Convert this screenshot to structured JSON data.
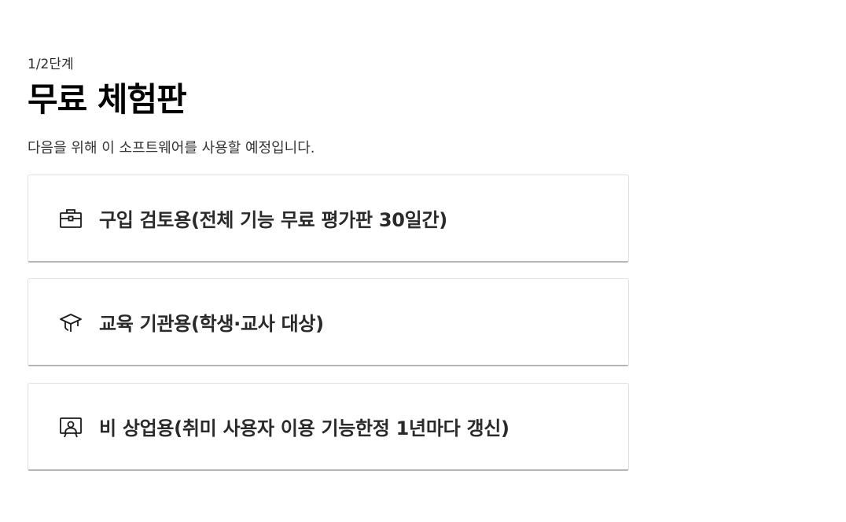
{
  "header": {
    "step": "1/2단계",
    "title": "무료 체험판",
    "subtitle": "다음을 위해 이 소프트웨어를 사용할 예정입니다."
  },
  "options": [
    {
      "icon": "briefcase-icon",
      "label": "구입 검토용(전체 기능 무료 평가판 30일간)"
    },
    {
      "icon": "graduation-cap-icon",
      "label": "교육 기관용(학생·교사 대상)"
    },
    {
      "icon": "presenter-icon",
      "label": "비 상업용(취미 사용자 이용 기능한정 1년마다 갱신)"
    }
  ],
  "colors": {
    "text": "#111111",
    "card_border": "#e1e1e1",
    "card_shadow_border": "#b5b5b5"
  }
}
